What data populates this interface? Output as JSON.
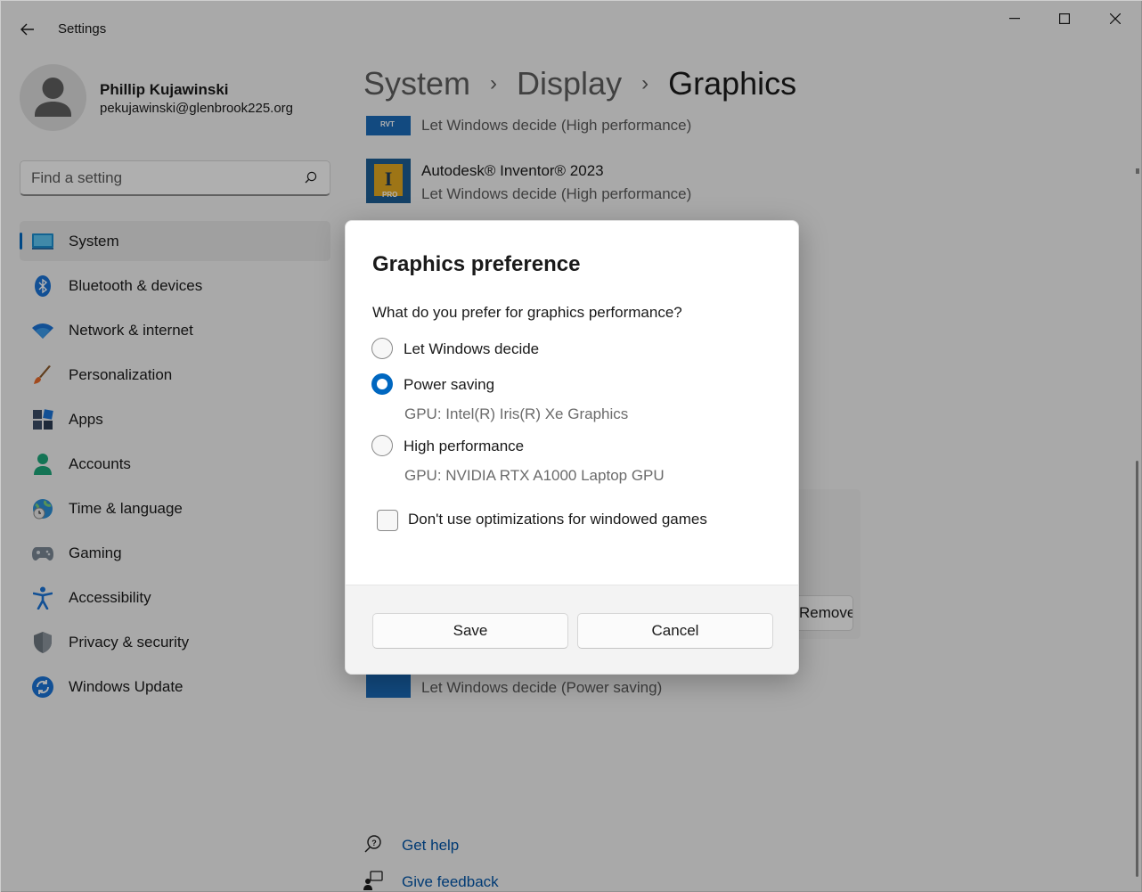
{
  "window": {
    "title": "Settings",
    "controls": [
      "minimize",
      "maximize",
      "close"
    ]
  },
  "profile": {
    "name": "Phillip Kujawinski",
    "email": "pekujawinski@glenbrook225.org"
  },
  "search": {
    "placeholder": "Find a setting"
  },
  "sidebar": {
    "items": [
      {
        "label": "System",
        "icon": "system-icon",
        "active": true
      },
      {
        "label": "Bluetooth & devices",
        "icon": "bluetooth-icon"
      },
      {
        "label": "Network & internet",
        "icon": "wifi-icon"
      },
      {
        "label": "Personalization",
        "icon": "brush-icon"
      },
      {
        "label": "Apps",
        "icon": "apps-icon"
      },
      {
        "label": "Accounts",
        "icon": "account-icon"
      },
      {
        "label": "Time & language",
        "icon": "globe-clock-icon"
      },
      {
        "label": "Gaming",
        "icon": "gamepad-icon"
      },
      {
        "label": "Accessibility",
        "icon": "accessibility-icon"
      },
      {
        "label": "Privacy & security",
        "icon": "shield-icon"
      },
      {
        "label": "Windows Update",
        "icon": "update-icon"
      }
    ]
  },
  "breadcrumb": [
    "System",
    "Display",
    "Graphics"
  ],
  "apps": [
    {
      "tile_text": "RVT",
      "name": "",
      "pref": "Let Windows decide (High performance)"
    },
    {
      "tile_text": "PRO",
      "name": "Autodesk® Inventor® 2023",
      "pref": "Let Windows decide (High performance)"
    },
    {
      "tile_text": "",
      "name": "",
      "pref": "Let Windows decide (Power saving)"
    }
  ],
  "background": {
    "remove_button": "Remove"
  },
  "help": {
    "get_help": "Get help",
    "give_feedback": "Give feedback"
  },
  "dialog": {
    "title": "Graphics preference",
    "question": "What do you prefer for graphics performance?",
    "options": [
      {
        "label": "Let Windows decide",
        "checked": false,
        "gpu": ""
      },
      {
        "label": "Power saving",
        "checked": true,
        "gpu": "GPU: Intel(R) Iris(R) Xe Graphics"
      },
      {
        "label": "High performance",
        "checked": false,
        "gpu": "GPU: NVIDIA RTX A1000 Laptop GPU"
      }
    ],
    "checkbox_label": "Don't use optimizations for windowed games",
    "checkbox_checked": false,
    "save_label": "Save",
    "cancel_label": "Cancel"
  },
  "colors": {
    "accent": "#0067c0",
    "link": "#0054a6"
  }
}
